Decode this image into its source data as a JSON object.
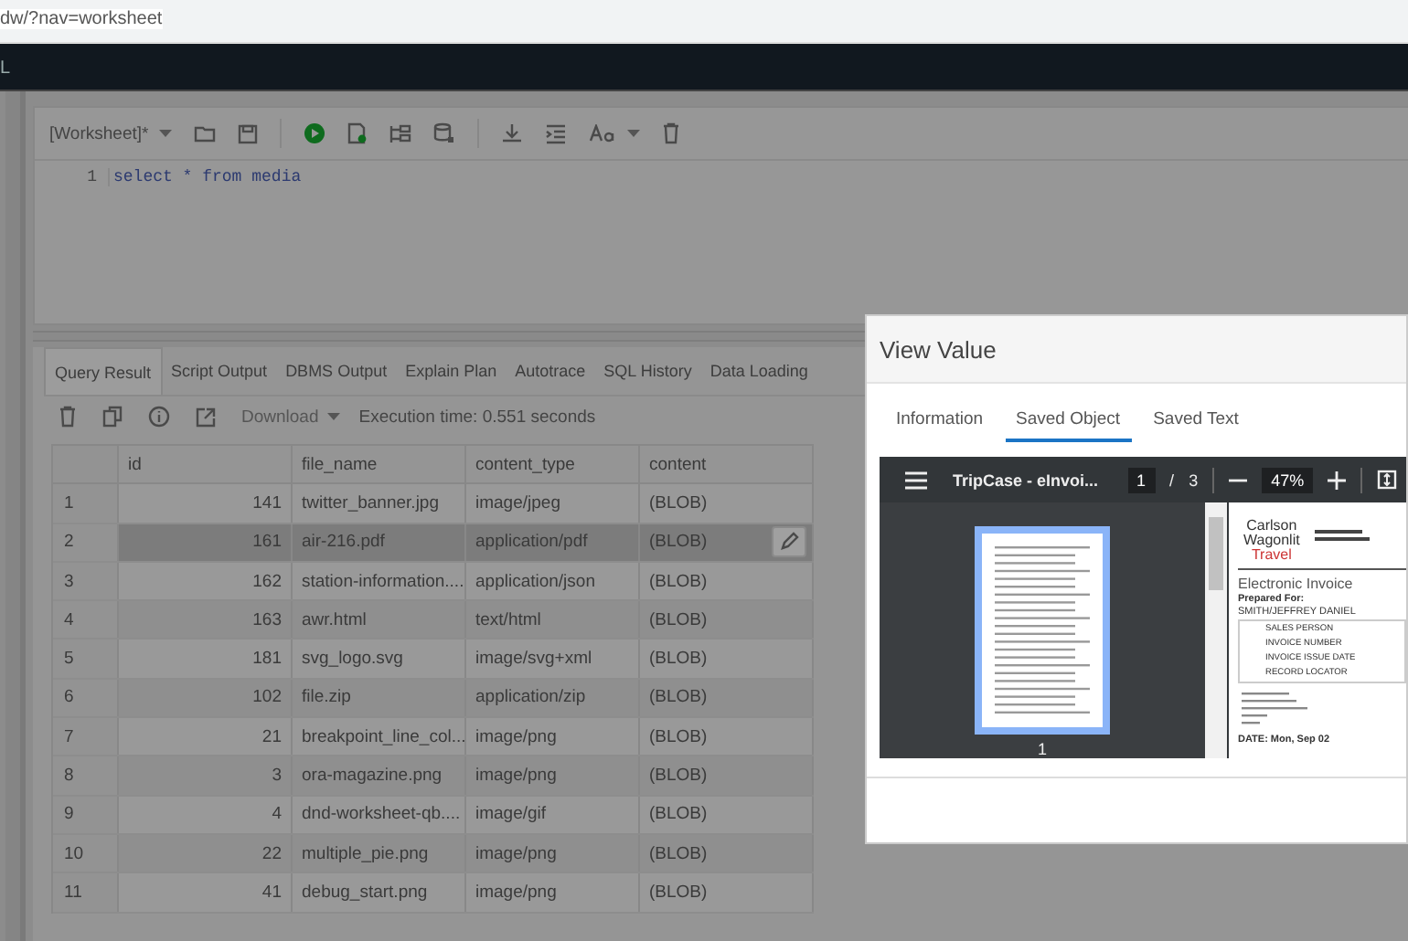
{
  "browser": {
    "url": "dw/?nav=worksheet"
  },
  "app_bar": {
    "title": "L"
  },
  "worksheet": {
    "name": "[Worksheet]*",
    "lines": [
      {
        "number": "1",
        "code": "select * from media"
      }
    ]
  },
  "results": {
    "tabs": [
      {
        "label": "Query Result",
        "selected": true
      },
      {
        "label": "Script Output",
        "selected": false
      },
      {
        "label": "DBMS Output",
        "selected": false
      },
      {
        "label": "Explain Plan",
        "selected": false
      },
      {
        "label": "Autotrace",
        "selected": false
      },
      {
        "label": "SQL History",
        "selected": false
      },
      {
        "label": "Data Loading",
        "selected": false
      }
    ],
    "download": "Download",
    "execution_time": "Execution time: 0.551 seconds",
    "table": {
      "columns": [
        "id",
        "file_name",
        "content_type",
        "content"
      ],
      "rows": [
        {
          "number": "1",
          "cells": [
            "141",
            "twitter_banner.jpg",
            "image/jpeg",
            "(BLOB)"
          ],
          "selected": false
        },
        {
          "number": "2",
          "cells": [
            "161",
            "air-216.pdf",
            "application/pdf",
            "(BLOB)"
          ],
          "selected": true
        },
        {
          "number": "3",
          "cells": [
            "162",
            "station-information....",
            "application/json",
            "(BLOB)"
          ],
          "selected": false
        },
        {
          "number": "4",
          "cells": [
            "163",
            "awr.html",
            "text/html",
            "(BLOB)"
          ],
          "selected": false
        },
        {
          "number": "5",
          "cells": [
            "181",
            "svg_logo.svg",
            "image/svg+xml",
            "(BLOB)"
          ],
          "selected": false
        },
        {
          "number": "6",
          "cells": [
            "102",
            "file.zip",
            "application/zip",
            "(BLOB)"
          ],
          "selected": false
        },
        {
          "number": "7",
          "cells": [
            "21",
            "breakpoint_line_col...",
            "image/png",
            "(BLOB)"
          ],
          "selected": false
        },
        {
          "number": "8",
          "cells": [
            "3",
            "ora-magazine.png",
            "image/png",
            "(BLOB)"
          ],
          "selected": false
        },
        {
          "number": "9",
          "cells": [
            "4",
            "dnd-worksheet-qb....",
            "image/gif",
            "(BLOB)"
          ],
          "selected": false
        },
        {
          "number": "10",
          "cells": [
            "22",
            "multiple_pie.png",
            "image/png",
            "(BLOB)"
          ],
          "selected": false
        },
        {
          "number": "11",
          "cells": [
            "41",
            "debug_start.png",
            "image/png",
            "(BLOB)"
          ],
          "selected": false
        }
      ]
    }
  },
  "dialog": {
    "title": "View Value",
    "tabs": [
      {
        "label": "Information",
        "selected": false
      },
      {
        "label": "Saved Object",
        "selected": true
      },
      {
        "label": "Saved Text",
        "selected": false
      }
    ],
    "pdf_viewer": {
      "title": "TripCase - eInvoi...",
      "page": "1",
      "page_separator": "/",
      "page_count": "3",
      "zoom": "47%",
      "thumbnails": [
        {
          "label": "1",
          "selected": true
        }
      ],
      "document": {
        "logo": [
          "Carlson",
          "Wagonlit",
          "Travel"
        ],
        "heading": "Electronic Invoice",
        "prepared_for_label": "Prepared For:",
        "prepared_for": "SMITH/JEFFREY DANIEL",
        "fields": [
          "SALES PERSON",
          "INVOICE NUMBER",
          "INVOICE ISSUE DATE",
          "RECORD LOCATOR"
        ],
        "date": "DATE: Mon, Sep 02"
      }
    }
  }
}
